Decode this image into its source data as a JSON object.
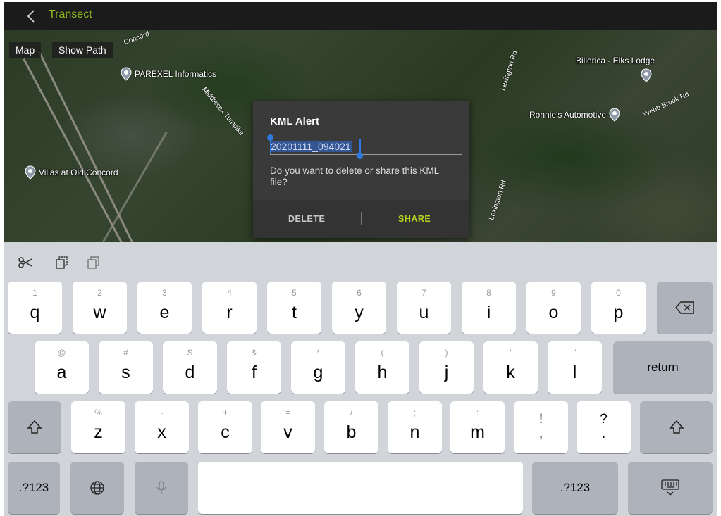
{
  "header": {
    "title": "Transect",
    "title_color": "#8fb81e"
  },
  "map": {
    "buttons": {
      "map": "Map",
      "show_path": "Show Path"
    },
    "pois": [
      "PAREXEL Informatics",
      "Villas at Old Concord",
      "Billerica - Elks Lodge",
      "Ronnie's Automotive"
    ],
    "roads": [
      "Concord",
      "Middlesex Turnpike",
      "Lexington Rd",
      "Lexington Rd",
      "Webb Brook Rd",
      "Lexington Rd"
    ]
  },
  "dialog": {
    "title": "KML Alert",
    "input_value": "20201111_094021",
    "message": "Do you want to delete or share this KML file?",
    "delete_label": "DELETE",
    "share_label": "SHARE",
    "share_color": "#b5d61c"
  },
  "keyboard": {
    "row1": [
      {
        "hint": "1",
        "key": "q"
      },
      {
        "hint": "2",
        "key": "w"
      },
      {
        "hint": "3",
        "key": "e"
      },
      {
        "hint": "4",
        "key": "r"
      },
      {
        "hint": "5",
        "key": "t"
      },
      {
        "hint": "6",
        "key": "y"
      },
      {
        "hint": "7",
        "key": "u"
      },
      {
        "hint": "8",
        "key": "i"
      },
      {
        "hint": "9",
        "key": "o"
      },
      {
        "hint": "0",
        "key": "p"
      }
    ],
    "row2": [
      {
        "hint": "@",
        "key": "a"
      },
      {
        "hint": "#",
        "key": "s"
      },
      {
        "hint": "$",
        "key": "d"
      },
      {
        "hint": "&",
        "key": "f"
      },
      {
        "hint": "*",
        "key": "g"
      },
      {
        "hint": "(",
        "key": "h"
      },
      {
        "hint": ")",
        "key": "j"
      },
      {
        "hint": "’",
        "key": "k"
      },
      {
        "hint": "”",
        "key": "l"
      }
    ],
    "row3": [
      {
        "hint": "%",
        "key": "z"
      },
      {
        "hint": "-",
        "key": "x"
      },
      {
        "hint": "+",
        "key": "c"
      },
      {
        "hint": "=",
        "key": "v"
      },
      {
        "hint": "/",
        "key": "b"
      },
      {
        "hint": ";",
        "key": "n"
      },
      {
        "hint": ":",
        "key": "m"
      }
    ],
    "punct": [
      {
        "top": "!",
        "bottom": ","
      },
      {
        "top": "?",
        "bottom": "."
      }
    ],
    "return_label": "return",
    "numeric_label": ".?123"
  }
}
